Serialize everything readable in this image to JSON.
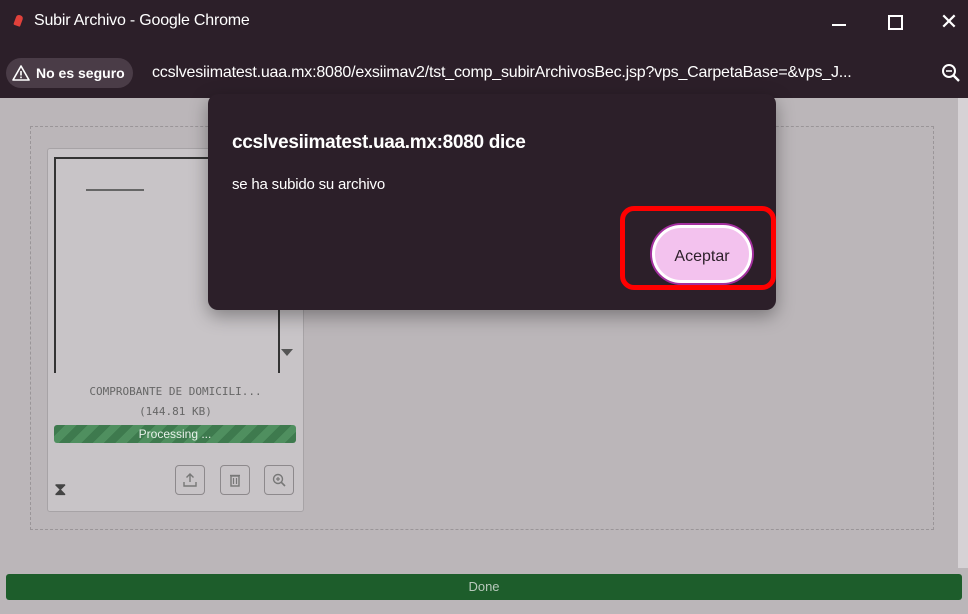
{
  "window": {
    "title": "Subir Archivo - Google Chrome",
    "minimize_icon": "minimize-icon",
    "maximize_icon": "maximize-icon",
    "close_glyph": "✕"
  },
  "address_bar": {
    "security_label": "No es seguro",
    "url": "ccslvesiimatest.uaa.mx:8080/exsiimav2/tst_comp_subirArchivosBec.jsp?vps_CarpetaBase=&vps_J..."
  },
  "file_card": {
    "file_name": "COMPROBANTE DE DOMICILI...",
    "file_size": "(144.81 KB)",
    "status": "Processing ..."
  },
  "footer": {
    "done_label": "Done"
  },
  "dialog": {
    "title": "ccslvesiimatest.uaa.mx:8080 dice",
    "message": "se ha subido su archivo",
    "accept_label": "Aceptar"
  },
  "colors": {
    "chrome_frame": "#2c1f29",
    "dialog_bg": "#2c1f29",
    "accept_button": "#f3c2ee",
    "highlight": "#ff0000",
    "progress": "#3e7a4e",
    "done_bar": "#1d5d2b"
  }
}
